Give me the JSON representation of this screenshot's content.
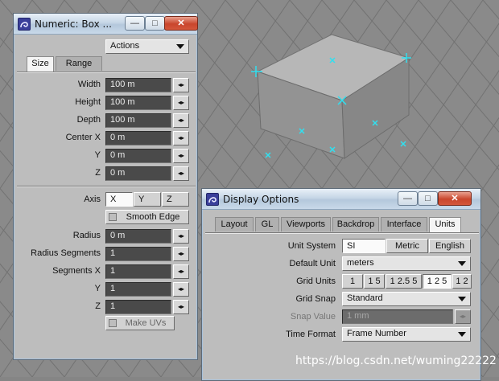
{
  "numeric_window": {
    "title": "Numeric: Box ...",
    "actions_label": "Actions",
    "tabs": [
      "Size",
      "Range"
    ],
    "fields": [
      {
        "label": "Width",
        "value": "100 m"
      },
      {
        "label": "Height",
        "value": "100 m"
      },
      {
        "label": "Depth",
        "value": "100 m"
      },
      {
        "label": "Center X",
        "value": "0 m"
      },
      {
        "label": "Y",
        "value": "0 m"
      },
      {
        "label": "Z",
        "value": "0 m"
      }
    ],
    "axis_label": "Axis",
    "axis_options": [
      "X",
      "Y",
      "Z"
    ],
    "smooth_edge_label": "Smooth Edge",
    "round_fields": [
      {
        "label": "Radius",
        "value": "0 m"
      },
      {
        "label": "Radius Segments",
        "value": "1"
      },
      {
        "label": "Segments X",
        "value": "1"
      },
      {
        "label": "Y",
        "value": "1"
      },
      {
        "label": "Z",
        "value": "1"
      }
    ],
    "make_uvs_label": "Make UVs"
  },
  "display_window": {
    "title": "Display Options",
    "tabs": [
      "Layout",
      "GL",
      "Viewports",
      "Backdrop",
      "Interface",
      "Units"
    ],
    "active_tab": "Units",
    "unit_system_label": "Unit System",
    "unit_system_options": [
      "SI",
      "Metric",
      "English"
    ],
    "default_unit_label": "Default Unit",
    "default_unit_value": "meters",
    "grid_units_label": "Grid Units",
    "grid_units_options": [
      "1",
      "1 5",
      "1 2.5 5",
      "1 2 5",
      "1 2"
    ],
    "grid_snap_label": "Grid Snap",
    "grid_snap_value": "Standard",
    "snap_value_label": "Snap Value",
    "snap_value_value": "1 mm",
    "time_format_label": "Time Format",
    "time_format_value": "Frame Number"
  },
  "window_controls": {
    "minimize": "—",
    "maximize": "□",
    "close": "✕"
  },
  "spinner_glyph": "◂▸",
  "watermark": "https://blog.csdn.net/wuming22222",
  "colors": {
    "viewport_bg": "#8a8a8a",
    "box_top": "#b8b8b8",
    "box_side": "#8e8e8e",
    "handle": "#30e0f0",
    "panel": "#bdbdbd",
    "field": "#4a4a4a"
  }
}
